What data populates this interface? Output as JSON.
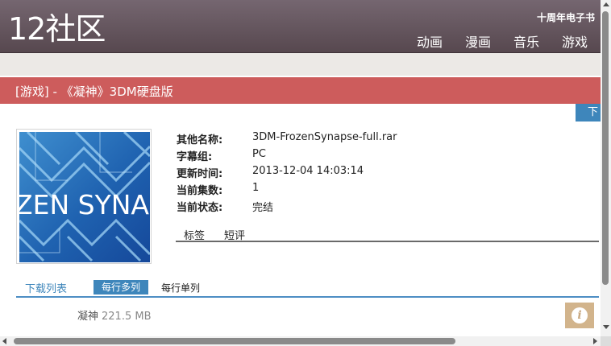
{
  "header": {
    "logo": "12社区",
    "slogan": "十周年电子书",
    "nav": [
      "动画",
      "漫画",
      "音乐",
      "游戏"
    ]
  },
  "title": "[游戏] - 《凝神》3DM硬盘版",
  "download_tab": "下",
  "cover": {
    "text": "ZEN SYNA",
    "icon": "cover-art-image"
  },
  "info": [
    {
      "key": "其他名称:",
      "value": "3DM-FrozenSynapse-full.rar"
    },
    {
      "key": "字幕组:",
      "value": "PC"
    },
    {
      "key": "更新时间:",
      "value": "2013-12-04 14:03:14"
    },
    {
      "key": "当前集数:",
      "value": "1"
    },
    {
      "key": "当前状态:",
      "value": "完结"
    }
  ],
  "subtabs": [
    "标签",
    "短评"
  ],
  "download_list": {
    "label": "下载列表",
    "multi": "每行多列",
    "single": "每行单列"
  },
  "file": {
    "name": "凝神",
    "size": "221.5 MB"
  },
  "info_button_glyph": "i",
  "colors": {
    "header": "#5f5057",
    "titlebar": "#cd5c5c",
    "accent": "#3e86bb",
    "info_button": "#d2b48c"
  }
}
